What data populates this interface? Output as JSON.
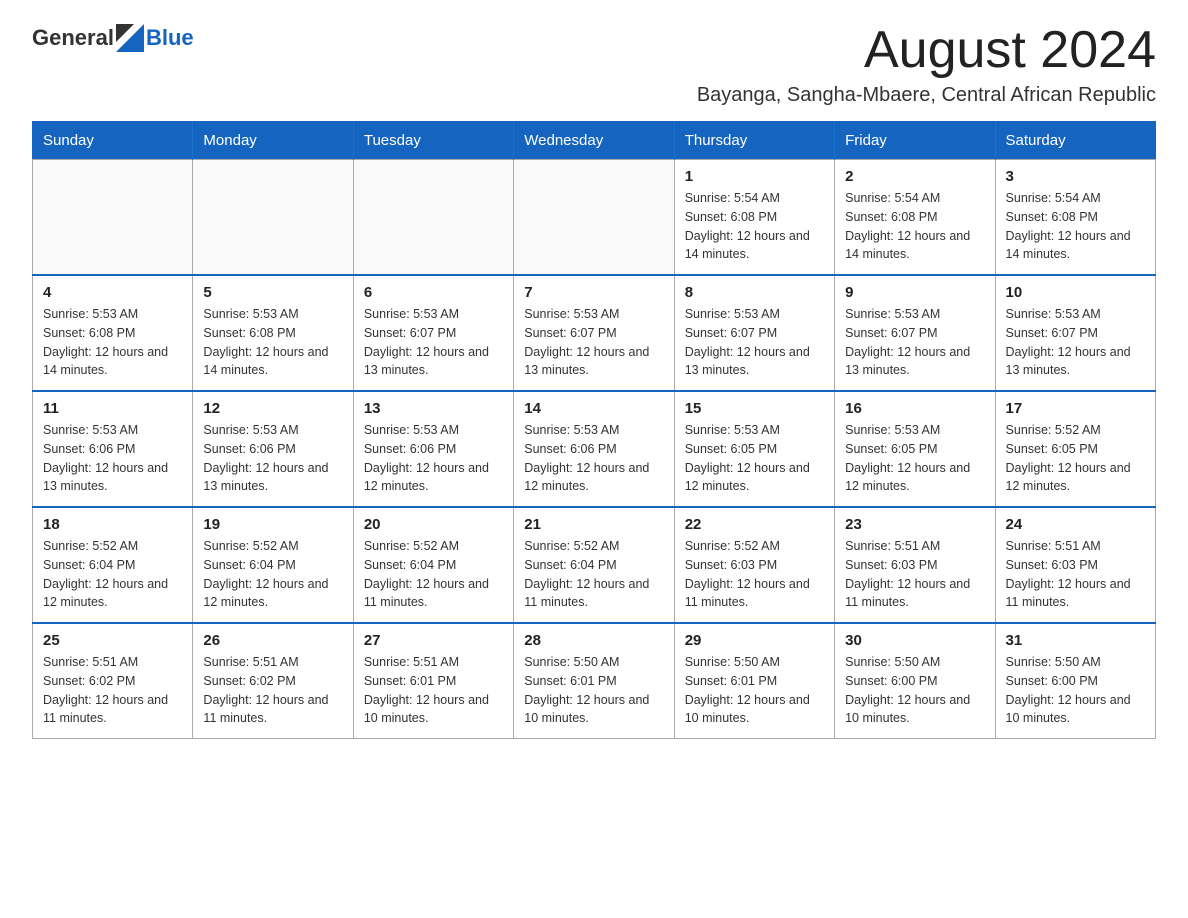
{
  "header": {
    "logo_general": "General",
    "logo_blue": "Blue",
    "month_title": "August 2024",
    "subtitle": "Bayanga, Sangha-Mbaere, Central African Republic"
  },
  "days_of_week": [
    "Sunday",
    "Monday",
    "Tuesday",
    "Wednesday",
    "Thursday",
    "Friday",
    "Saturday"
  ],
  "weeks": [
    {
      "days": [
        {
          "number": "",
          "info": ""
        },
        {
          "number": "",
          "info": ""
        },
        {
          "number": "",
          "info": ""
        },
        {
          "number": "",
          "info": ""
        },
        {
          "number": "1",
          "info": "Sunrise: 5:54 AM\nSunset: 6:08 PM\nDaylight: 12 hours and 14 minutes."
        },
        {
          "number": "2",
          "info": "Sunrise: 5:54 AM\nSunset: 6:08 PM\nDaylight: 12 hours and 14 minutes."
        },
        {
          "number": "3",
          "info": "Sunrise: 5:54 AM\nSunset: 6:08 PM\nDaylight: 12 hours and 14 minutes."
        }
      ]
    },
    {
      "days": [
        {
          "number": "4",
          "info": "Sunrise: 5:53 AM\nSunset: 6:08 PM\nDaylight: 12 hours and 14 minutes."
        },
        {
          "number": "5",
          "info": "Sunrise: 5:53 AM\nSunset: 6:08 PM\nDaylight: 12 hours and 14 minutes."
        },
        {
          "number": "6",
          "info": "Sunrise: 5:53 AM\nSunset: 6:07 PM\nDaylight: 12 hours and 13 minutes."
        },
        {
          "number": "7",
          "info": "Sunrise: 5:53 AM\nSunset: 6:07 PM\nDaylight: 12 hours and 13 minutes."
        },
        {
          "number": "8",
          "info": "Sunrise: 5:53 AM\nSunset: 6:07 PM\nDaylight: 12 hours and 13 minutes."
        },
        {
          "number": "9",
          "info": "Sunrise: 5:53 AM\nSunset: 6:07 PM\nDaylight: 12 hours and 13 minutes."
        },
        {
          "number": "10",
          "info": "Sunrise: 5:53 AM\nSunset: 6:07 PM\nDaylight: 12 hours and 13 minutes."
        }
      ]
    },
    {
      "days": [
        {
          "number": "11",
          "info": "Sunrise: 5:53 AM\nSunset: 6:06 PM\nDaylight: 12 hours and 13 minutes."
        },
        {
          "number": "12",
          "info": "Sunrise: 5:53 AM\nSunset: 6:06 PM\nDaylight: 12 hours and 13 minutes."
        },
        {
          "number": "13",
          "info": "Sunrise: 5:53 AM\nSunset: 6:06 PM\nDaylight: 12 hours and 12 minutes."
        },
        {
          "number": "14",
          "info": "Sunrise: 5:53 AM\nSunset: 6:06 PM\nDaylight: 12 hours and 12 minutes."
        },
        {
          "number": "15",
          "info": "Sunrise: 5:53 AM\nSunset: 6:05 PM\nDaylight: 12 hours and 12 minutes."
        },
        {
          "number": "16",
          "info": "Sunrise: 5:53 AM\nSunset: 6:05 PM\nDaylight: 12 hours and 12 minutes."
        },
        {
          "number": "17",
          "info": "Sunrise: 5:52 AM\nSunset: 6:05 PM\nDaylight: 12 hours and 12 minutes."
        }
      ]
    },
    {
      "days": [
        {
          "number": "18",
          "info": "Sunrise: 5:52 AM\nSunset: 6:04 PM\nDaylight: 12 hours and 12 minutes."
        },
        {
          "number": "19",
          "info": "Sunrise: 5:52 AM\nSunset: 6:04 PM\nDaylight: 12 hours and 12 minutes."
        },
        {
          "number": "20",
          "info": "Sunrise: 5:52 AM\nSunset: 6:04 PM\nDaylight: 12 hours and 11 minutes."
        },
        {
          "number": "21",
          "info": "Sunrise: 5:52 AM\nSunset: 6:04 PM\nDaylight: 12 hours and 11 minutes."
        },
        {
          "number": "22",
          "info": "Sunrise: 5:52 AM\nSunset: 6:03 PM\nDaylight: 12 hours and 11 minutes."
        },
        {
          "number": "23",
          "info": "Sunrise: 5:51 AM\nSunset: 6:03 PM\nDaylight: 12 hours and 11 minutes."
        },
        {
          "number": "24",
          "info": "Sunrise: 5:51 AM\nSunset: 6:03 PM\nDaylight: 12 hours and 11 minutes."
        }
      ]
    },
    {
      "days": [
        {
          "number": "25",
          "info": "Sunrise: 5:51 AM\nSunset: 6:02 PM\nDaylight: 12 hours and 11 minutes."
        },
        {
          "number": "26",
          "info": "Sunrise: 5:51 AM\nSunset: 6:02 PM\nDaylight: 12 hours and 11 minutes."
        },
        {
          "number": "27",
          "info": "Sunrise: 5:51 AM\nSunset: 6:01 PM\nDaylight: 12 hours and 10 minutes."
        },
        {
          "number": "28",
          "info": "Sunrise: 5:50 AM\nSunset: 6:01 PM\nDaylight: 12 hours and 10 minutes."
        },
        {
          "number": "29",
          "info": "Sunrise: 5:50 AM\nSunset: 6:01 PM\nDaylight: 12 hours and 10 minutes."
        },
        {
          "number": "30",
          "info": "Sunrise: 5:50 AM\nSunset: 6:00 PM\nDaylight: 12 hours and 10 minutes."
        },
        {
          "number": "31",
          "info": "Sunrise: 5:50 AM\nSunset: 6:00 PM\nDaylight: 12 hours and 10 minutes."
        }
      ]
    }
  ]
}
